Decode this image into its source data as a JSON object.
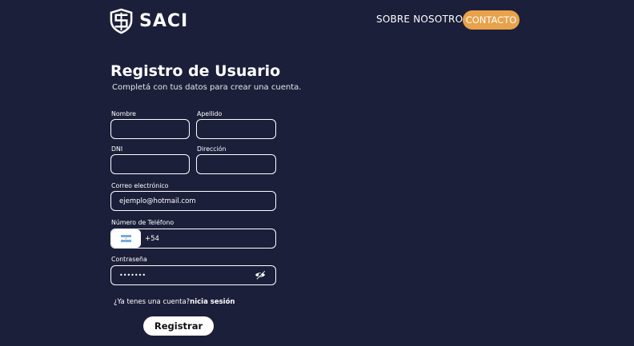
{
  "header": {
    "brand": "SACI",
    "nav": {
      "about": "SOBRE NOSOTROS",
      "contact": "CONTACTO"
    }
  },
  "colors": {
    "background": "#1c1f3a",
    "accent": "#e8a24a",
    "text": "#ffffff"
  },
  "form": {
    "title": "Registro de Usuario",
    "subtitle": "Completá con tus datos para crear una cuenta.",
    "fields": {
      "nombre": {
        "label": "Nombre",
        "value": ""
      },
      "apellido": {
        "label": "Apellido",
        "value": ""
      },
      "dni": {
        "label": "DNI",
        "value": ""
      },
      "direccion": {
        "label": "Dirección",
        "value": ""
      },
      "email": {
        "label": "Correo electrónico",
        "placeholder": "ejemplo@hotmail.com"
      },
      "telefono": {
        "label": "Número de Teléfono",
        "prefix": "+54",
        "country_icon": "argentina-flag-icon"
      },
      "password": {
        "label": "Contraseña",
        "value": "•••••••",
        "toggle_icon": "eye-slash-icon"
      }
    },
    "login_prompt": "¿Ya tenes una cuenta?",
    "login_link": "nicia sesión",
    "submit_label": "Registrar"
  }
}
